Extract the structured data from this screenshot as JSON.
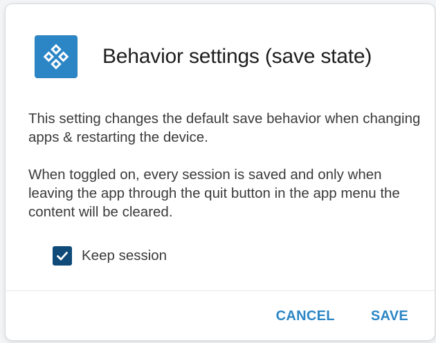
{
  "dialog": {
    "title": "Behavior settings (save state)",
    "icon": "app-logo-icon",
    "paragraphs": [
      "This setting changes the default save behavior when changing apps & restarting the device.",
      "When toggled on, every session is saved and only when leaving the app through the quit button in the app menu the content will be cleared."
    ],
    "checkbox": {
      "label": "Keep session",
      "checked": true
    },
    "buttons": {
      "cancel": "CANCEL",
      "save": "SAVE"
    },
    "colors": {
      "accent": "#2c86c6",
      "checkbox": "#0f4a78"
    }
  }
}
